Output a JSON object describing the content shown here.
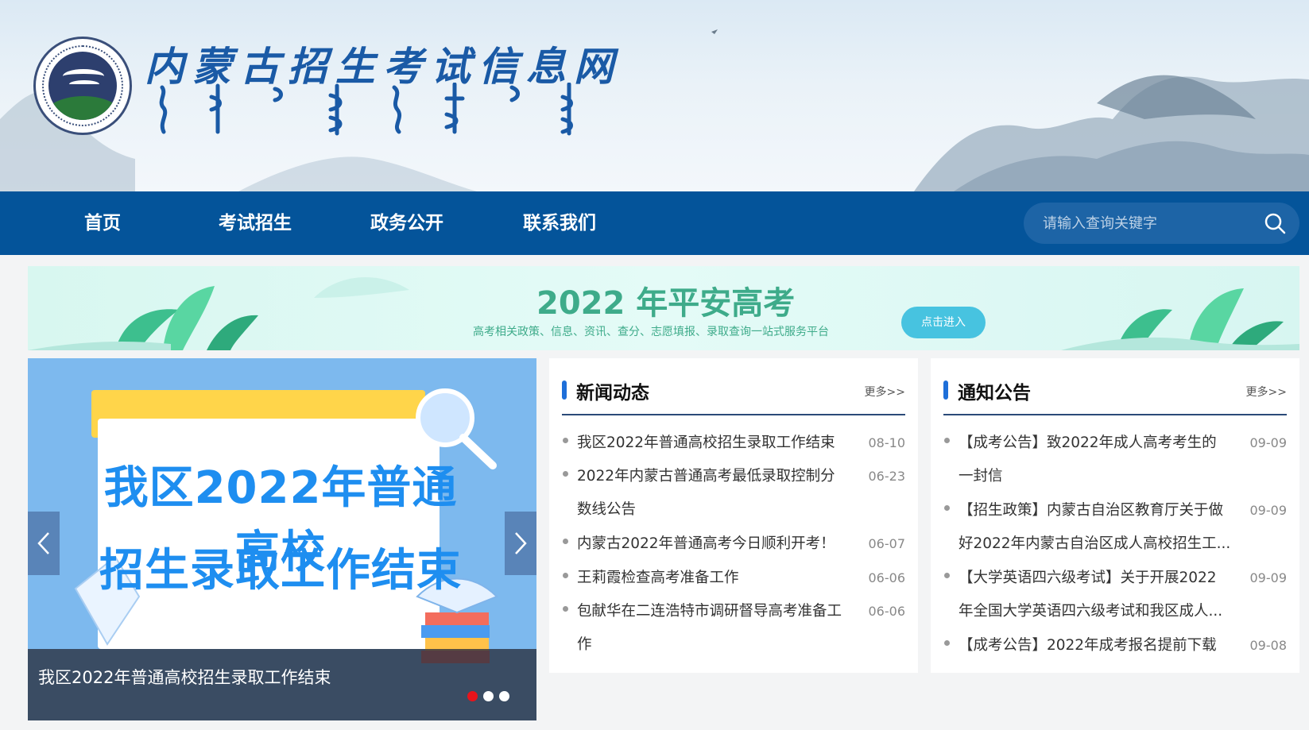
{
  "header": {
    "site_title": "内蒙古招生考试信息网"
  },
  "nav": {
    "items": [
      {
        "label": "首页"
      },
      {
        "label": "考试招生"
      },
      {
        "label": "政务公开"
      },
      {
        "label": "联系我们"
      }
    ],
    "search_placeholder": "请输入查询关键字"
  },
  "banner": {
    "title": "2022 年平安高考",
    "subtitle": "高考相关政策、信息、资讯、查分、志愿填报、录取查询一站式服务平台",
    "button": "点击进入"
  },
  "carousel": {
    "slide_line1": "我区2022年普通高校",
    "slide_line2": "招生录取工作结束",
    "caption": "我区2022年普通高校招生录取工作结束",
    "dots_total": 3,
    "active_dot": 1
  },
  "news": {
    "title": "新闻动态",
    "more": "更多>>",
    "items": [
      {
        "lines": [
          "我区2022年普通高校招生录取工作结束"
        ],
        "date": "08-10"
      },
      {
        "lines": [
          "2022年内蒙古普通高考最低录取控制分",
          "数线公告"
        ],
        "date": "06-23"
      },
      {
        "lines": [
          "内蒙古2022年普通高考今日顺利开考！"
        ],
        "date": "06-07"
      },
      {
        "lines": [
          "王莉霞检查高考准备工作"
        ],
        "date": "06-06"
      },
      {
        "lines": [
          "包献华在二连浩特市调研督导高考准备工",
          "作"
        ],
        "date": "06-06"
      }
    ]
  },
  "notices": {
    "title": "通知公告",
    "more": "更多>>",
    "items": [
      {
        "lines": [
          "【成考公告】致2022年成人高考考生的",
          "一封信"
        ],
        "date": "09-09"
      },
      {
        "lines": [
          "【招生政策】内蒙古自治区教育厅关于做",
          "好2022年内蒙古自治区成人高校招生工..."
        ],
        "date": "09-09"
      },
      {
        "lines": [
          "【大学英语四六级考试】关于开展2022",
          "年全国大学英语四六级考试和我区成人..."
        ],
        "date": "09-09"
      },
      {
        "lines": [
          "【成考公告】2022年成考报名提前下载"
        ],
        "date": "09-08"
      }
    ]
  },
  "colors": {
    "nav_bg": "#04549a",
    "title_blue": "#1a5aa6",
    "banner_green": "#3eab8a",
    "active_dot": "#e8141b"
  }
}
